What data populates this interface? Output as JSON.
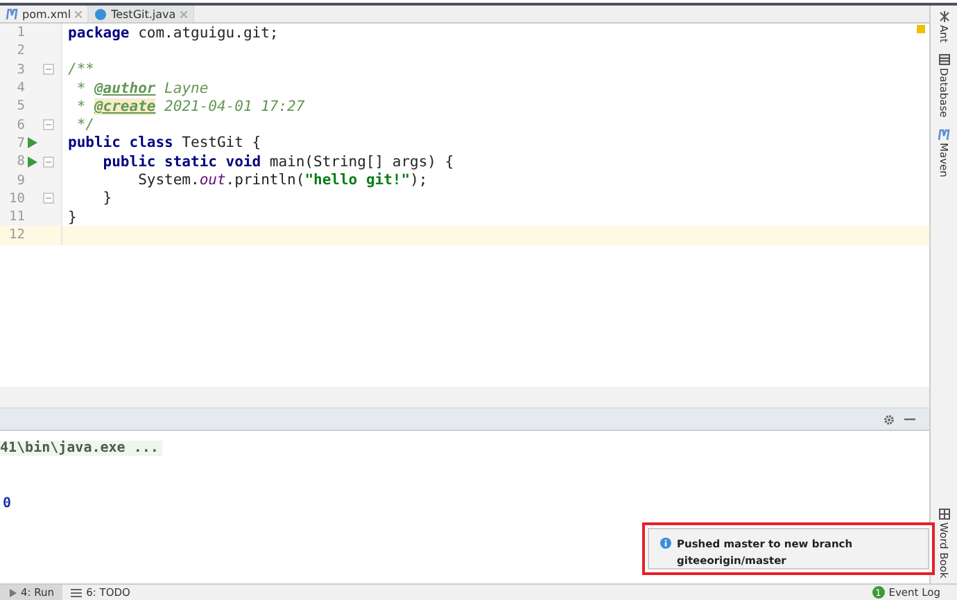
{
  "tabs": [
    {
      "label": "pom.xml",
      "kind": "maven",
      "selected": false
    },
    {
      "label": "TestGit.java",
      "kind": "java",
      "selected": true
    }
  ],
  "editor": {
    "lines": [
      {
        "number": "1",
        "tokens": [
          {
            "text": "package",
            "kind": "keyword"
          },
          {
            "text": " com.atguigu.git;",
            "kind": "plain"
          }
        ]
      },
      {
        "number": "2"
      },
      {
        "number": "3",
        "fold": true,
        "tokens": [
          {
            "text": "/**",
            "kind": "comment"
          }
        ]
      },
      {
        "number": "4",
        "tokens": [
          {
            "text": " * ",
            "kind": "comment"
          },
          {
            "text": "@author",
            "kind": "doctag"
          },
          {
            "text": " Layne",
            "kind": "comment"
          }
        ]
      },
      {
        "number": "5",
        "tokens": [
          {
            "text": " * ",
            "kind": "comment"
          },
          {
            "text": "@create",
            "kind": "doctag-hl"
          },
          {
            "text": " 2021-04-01 17:27",
            "kind": "comment"
          }
        ]
      },
      {
        "number": "6",
        "fold": true,
        "tokens": [
          {
            "text": " */",
            "kind": "comment"
          }
        ]
      },
      {
        "number": "7",
        "run": true,
        "tokens": [
          {
            "text": "public class",
            "kind": "keyword"
          },
          {
            "text": " TestGit {",
            "kind": "plain"
          }
        ]
      },
      {
        "number": "8",
        "run": true,
        "fold": true,
        "tokens": [
          {
            "text": "    public static void",
            "kind": "keyword"
          },
          {
            "text": " main(String[] args) {",
            "kind": "plain"
          }
        ]
      },
      {
        "number": "9",
        "tokens": [
          {
            "text": "        System.",
            "kind": "plain"
          },
          {
            "text": "out",
            "kind": "field"
          },
          {
            "text": ".println(",
            "kind": "plain"
          },
          {
            "text": "\"hello git!\"",
            "kind": "string"
          },
          {
            "text": ");",
            "kind": "plain"
          }
        ]
      },
      {
        "number": "10",
        "fold": true,
        "tokens": [
          {
            "text": "    }",
            "kind": "plain"
          }
        ]
      },
      {
        "number": "11",
        "tokens": [
          {
            "text": "}",
            "kind": "plain"
          }
        ]
      },
      {
        "number": "12",
        "current": true
      }
    ]
  },
  "right_tools": [
    {
      "label": "Ant",
      "kind": "ant"
    },
    {
      "label": "Database",
      "kind": "database"
    },
    {
      "label": "Maven",
      "kind": "maven"
    }
  ],
  "bottom_right_tool": {
    "label": "Word Book",
    "kind": "book"
  },
  "console": {
    "lines": [
      {
        "text": "41\\bin\\java.exe ...",
        "kind": "command"
      },
      {
        "text": "0",
        "kind": "exit"
      }
    ]
  },
  "notification": {
    "lines": [
      "Pushed master to new branch",
      "giteeorigin/master"
    ]
  },
  "status_bar": {
    "tabs": [
      {
        "label": "4: Run",
        "kind": "run",
        "selected": true
      },
      {
        "label": "6: TODO",
        "kind": "todo",
        "selected": false
      }
    ],
    "event_log": {
      "label": "Event Log",
      "count": "1"
    }
  }
}
